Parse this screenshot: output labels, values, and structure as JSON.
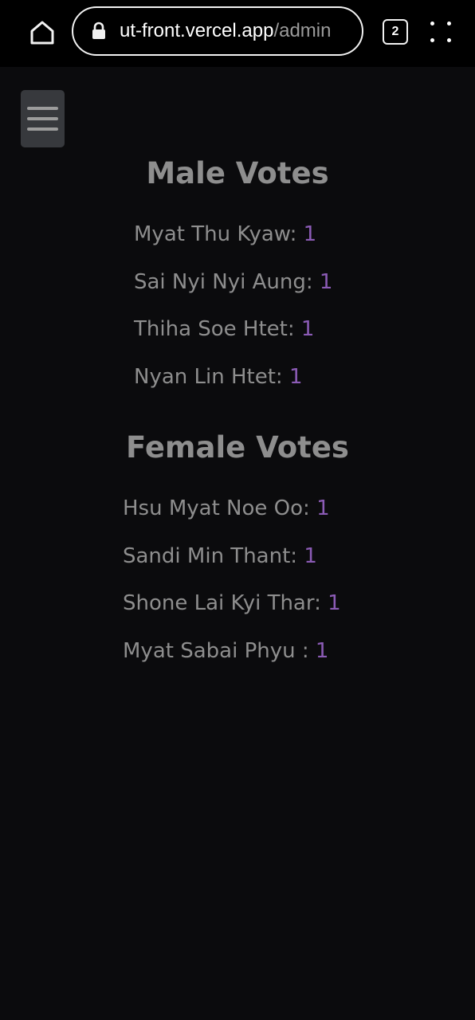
{
  "browser": {
    "url_host": "ut-front.vercel.app",
    "url_path": "/admin",
    "tab_count": "2"
  },
  "male": {
    "title": "Male Votes",
    "items": [
      {
        "name": "Myat Thu Kyaw:",
        "count": "1"
      },
      {
        "name": "Sai Nyi Nyi Aung:",
        "count": "1"
      },
      {
        "name": "Thiha Soe Htet:",
        "count": "1"
      },
      {
        "name": "Nyan Lin Htet:",
        "count": "1"
      }
    ]
  },
  "female": {
    "title": "Female Votes",
    "items": [
      {
        "name": "Hsu Myat Noe Oo:",
        "count": "1"
      },
      {
        "name": "Sandi Min Thant:",
        "count": "1"
      },
      {
        "name": "Shone Lai Kyi Thar:",
        "count": "1"
      },
      {
        "name": "Myat Sabai Phyu :",
        "count": "1"
      }
    ]
  },
  "colors": {
    "page_background": "#0b0b0d",
    "text": "#8e8e8e",
    "vote_count": "#8b5bb5",
    "menu_button_background": "#37393d"
  },
  "icons": {
    "home": "home-icon",
    "lock": "lock-icon",
    "tabs": "tab-switcher-icon",
    "menu": "more-options-icon",
    "hamburger": "hamburger-menu-icon"
  }
}
